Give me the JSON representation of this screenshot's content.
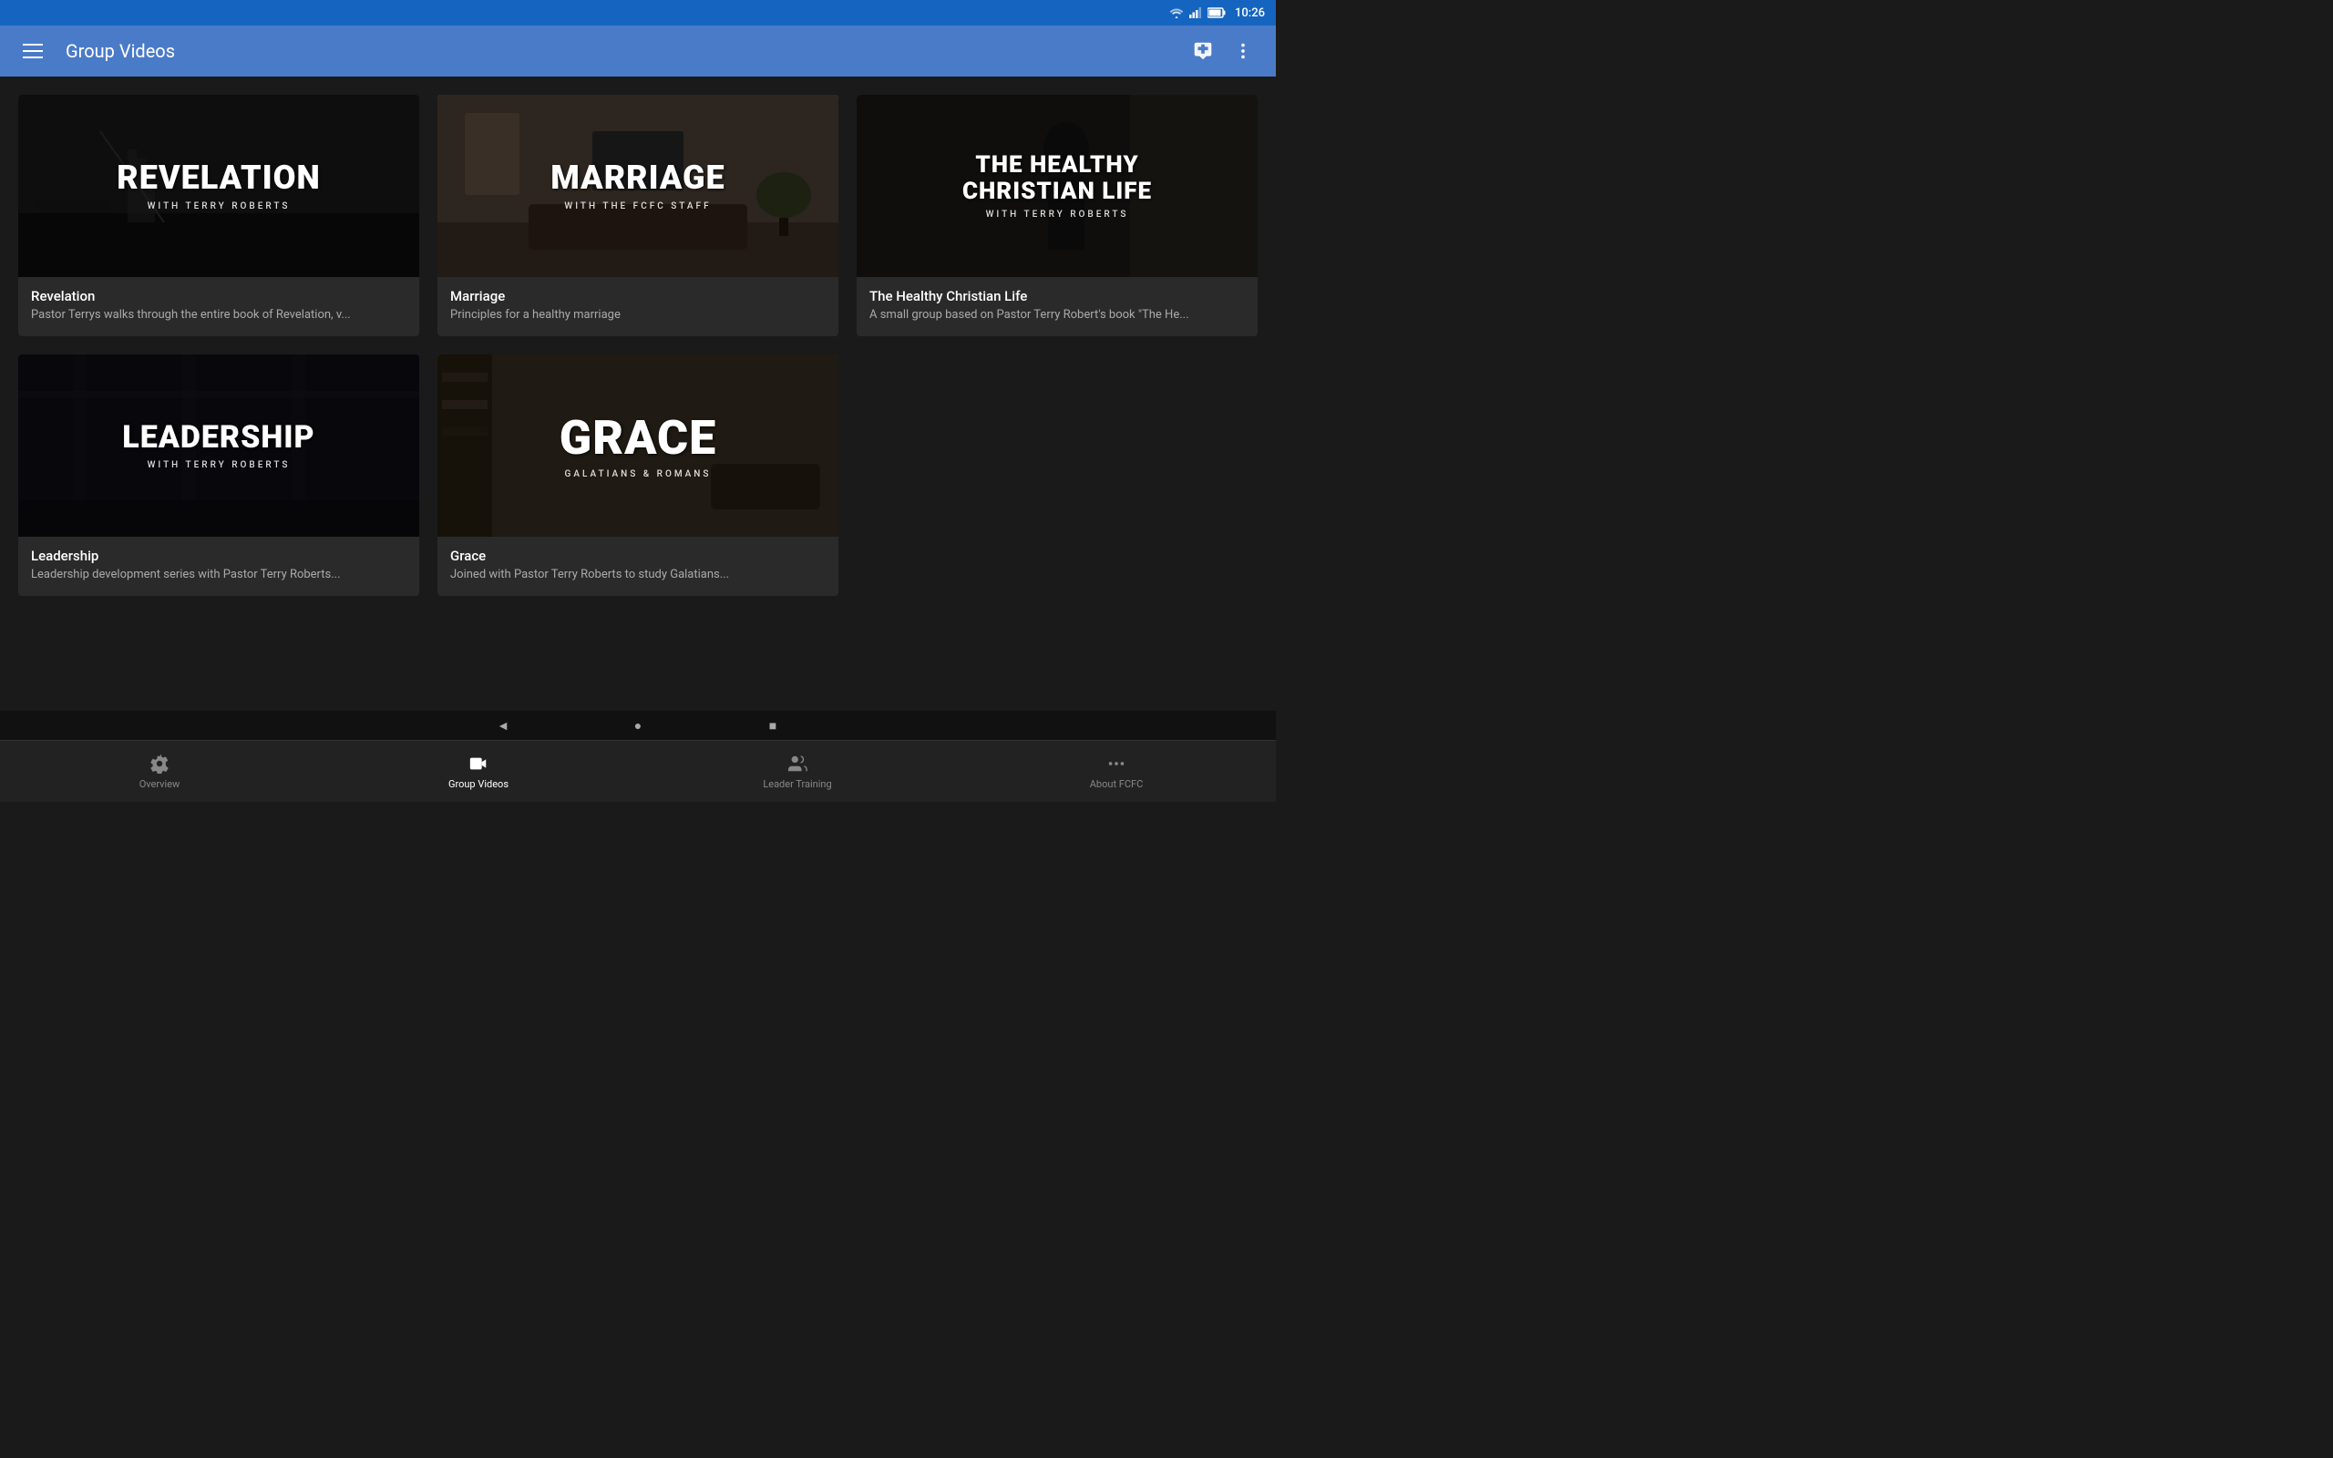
{
  "statusBar": {
    "time": "10:26",
    "wifi": "wifi",
    "signal": "signal",
    "battery": "battery"
  },
  "appBar": {
    "menuIcon": "menu",
    "title": "Group Videos",
    "chatIcon": "chat",
    "moreIcon": "more-vertical"
  },
  "videos": [
    {
      "id": "revelation",
      "thumbClass": "thumb-revelation",
      "thumbTitle": "REVELATION",
      "thumbSubtitle": "WITH TERRY ROBERTS",
      "name": "Revelation",
      "description": "Pastor Terrys walks through the entire book of Revelation, v..."
    },
    {
      "id": "marriage",
      "thumbClass": "thumb-marriage",
      "thumbTitle": "MARRIAGE",
      "thumbSubtitle": "WITH THE FCFC STAFF",
      "name": "Marriage",
      "description": "Principles for a healthy marriage"
    },
    {
      "id": "healthy",
      "thumbClass": "thumb-healthy",
      "thumbTitle": "THE HEALTHY\nCHRISTIAN LIFE",
      "thumbSubtitle": "WITH TERRY ROBERTS",
      "name": "The Healthy Christian Life",
      "description": "A small group based on Pastor Terry Robert's book \"The He..."
    },
    {
      "id": "leadership",
      "thumbClass": "thumb-leadership",
      "thumbTitle": "LEADERSHIP",
      "thumbSubtitle": "WITH TERRY ROBERTS",
      "name": "Leadership",
      "description": "Leadership development series with Pastor Terry Roberts..."
    },
    {
      "id": "grace",
      "thumbClass": "thumb-grace",
      "thumbTitle": "GRACE",
      "thumbSubtitle": "GALATIANS & ROMANS",
      "name": "Grace",
      "description": "Joined with Pastor Terry Roberts to study Galatians..."
    }
  ],
  "bottomNav": [
    {
      "id": "overview",
      "label": "Overview",
      "icon": "grid",
      "active": false
    },
    {
      "id": "group-videos",
      "label": "Group Videos",
      "icon": "video",
      "active": true
    },
    {
      "id": "leader-training",
      "label": "Leader Training",
      "icon": "users",
      "active": false
    },
    {
      "id": "about",
      "label": "About FCFC",
      "icon": "dots",
      "active": false
    }
  ],
  "systemNav": {
    "back": "◄",
    "home": "●",
    "recent": "■"
  }
}
